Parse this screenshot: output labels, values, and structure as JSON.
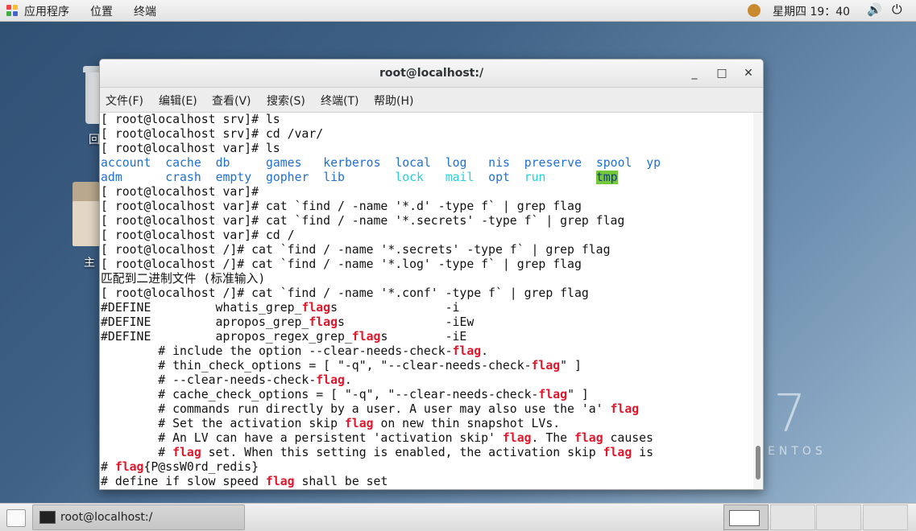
{
  "top_panel": {
    "applications": "应用程序",
    "places": "位置",
    "terminal": "终端",
    "clock": "星期四 19：40"
  },
  "desktop": {
    "trash_label": "回",
    "home_label": "主",
    "brand_number": "7",
    "brand_text": "ENTOS"
  },
  "window": {
    "title": "root@localhost:/",
    "minimize": "_",
    "maximize": "□",
    "close": "✕",
    "menu": [
      "文件(F)",
      "编辑(E)",
      "查看(V)",
      "搜索(S)",
      "终端(T)",
      "帮助(H)"
    ]
  },
  "terminal": {
    "lines": [
      [
        {
          "t": "[ root@localhost srv]# ls"
        }
      ],
      [
        {
          "t": "[ root@localhost srv]# cd /var/"
        }
      ],
      [
        {
          "t": "[ root@localhost var]# ls"
        }
      ],
      [
        {
          "t": "account",
          "c": "blue"
        },
        {
          "t": "  "
        },
        {
          "t": "cache",
          "c": "blue"
        },
        {
          "t": "  "
        },
        {
          "t": "db",
          "c": "blue"
        },
        {
          "t": "     "
        },
        {
          "t": "games",
          "c": "blue"
        },
        {
          "t": "   "
        },
        {
          "t": "kerberos",
          "c": "blue"
        },
        {
          "t": "  "
        },
        {
          "t": "local",
          "c": "blue"
        },
        {
          "t": "  "
        },
        {
          "t": "log",
          "c": "blue"
        },
        {
          "t": "   "
        },
        {
          "t": "nis",
          "c": "blue"
        },
        {
          "t": "  "
        },
        {
          "t": "preserve",
          "c": "blue"
        },
        {
          "t": "  "
        },
        {
          "t": "spool",
          "c": "blue"
        },
        {
          "t": "  "
        },
        {
          "t": "yp",
          "c": "blue"
        }
      ],
      [
        {
          "t": "adm",
          "c": "blue"
        },
        {
          "t": "      "
        },
        {
          "t": "crash",
          "c": "blue"
        },
        {
          "t": "  "
        },
        {
          "t": "empty",
          "c": "blue"
        },
        {
          "t": "  "
        },
        {
          "t": "gopher",
          "c": "blue"
        },
        {
          "t": "  "
        },
        {
          "t": "lib",
          "c": "blue"
        },
        {
          "t": "       "
        },
        {
          "t": "lock",
          "c": "cyan"
        },
        {
          "t": "   "
        },
        {
          "t": "mail",
          "c": "cyan"
        },
        {
          "t": "  "
        },
        {
          "t": "opt",
          "c": "blue"
        },
        {
          "t": "  "
        },
        {
          "t": "run",
          "c": "cyan"
        },
        {
          "t": "       "
        },
        {
          "t": "tmp",
          "c": "tmp"
        }
      ],
      [
        {
          "t": "[ root@localhost var]# "
        }
      ],
      [
        {
          "t": "[ root@localhost var]# cat `find / -name '*.d' -type f` | grep flag"
        }
      ],
      [
        {
          "t": "[ root@localhost var]# cat `find / -name '*.secrets' -type f` | grep flag"
        }
      ],
      [
        {
          "t": "[ root@localhost var]# cd /"
        }
      ],
      [
        {
          "t": "[ root@localhost /]# cat `find / -name '*.secrets' -type f` | grep flag"
        }
      ],
      [
        {
          "t": "[ root@localhost /]# cat `find / -name '*.log' -type f` | grep flag"
        }
      ],
      [
        {
          "t": "匹配到二进制文件 (标准输入)"
        }
      ],
      [
        {
          "t": "[ root@localhost /]# cat `find / -name '*.conf' -type f` | grep flag"
        }
      ],
      [
        {
          "t": "#DEFINE         whatis_grep_"
        },
        {
          "t": "flag",
          "c": "red"
        },
        {
          "t": "s               -i"
        }
      ],
      [
        {
          "t": "#DEFINE         apropos_grep_"
        },
        {
          "t": "flag",
          "c": "red"
        },
        {
          "t": "s              -iEw"
        }
      ],
      [
        {
          "t": "#DEFINE         apropos_regex_grep_"
        },
        {
          "t": "flag",
          "c": "red"
        },
        {
          "t": "s        -iE"
        }
      ],
      [
        {
          "t": "        # include the option --clear-needs-check-"
        },
        {
          "t": "flag",
          "c": "red"
        },
        {
          "t": "."
        }
      ],
      [
        {
          "t": "        # thin_check_options = [ \"-q\", \"--clear-needs-check-"
        },
        {
          "t": "flag",
          "c": "red"
        },
        {
          "t": "\" ]"
        }
      ],
      [
        {
          "t": "        # --clear-needs-check-"
        },
        {
          "t": "flag",
          "c": "red"
        },
        {
          "t": "."
        }
      ],
      [
        {
          "t": "        # cache_check_options = [ \"-q\", \"--clear-needs-check-"
        },
        {
          "t": "flag",
          "c": "red"
        },
        {
          "t": "\" ]"
        }
      ],
      [
        {
          "t": "        # commands run directly by a user. A user may also use the 'a' "
        },
        {
          "t": "flag",
          "c": "red"
        }
      ],
      [
        {
          "t": "        # Set the activation skip "
        },
        {
          "t": "flag",
          "c": "red"
        },
        {
          "t": " on new thin snapshot LVs."
        }
      ],
      [
        {
          "t": "        # An LV can have a persistent 'activation skip' "
        },
        {
          "t": "flag",
          "c": "red"
        },
        {
          "t": ". The "
        },
        {
          "t": "flag",
          "c": "red"
        },
        {
          "t": " causes"
        }
      ],
      [
        {
          "t": "        # "
        },
        {
          "t": "flag",
          "c": "red"
        },
        {
          "t": " set. When this setting is enabled, the activation skip "
        },
        {
          "t": "flag",
          "c": "red"
        },
        {
          "t": " is"
        }
      ],
      [
        {
          "t": "# "
        },
        {
          "t": "flag",
          "c": "red"
        },
        {
          "t": "{P@ssW0rd_redis}"
        }
      ],
      [
        {
          "t": "# define if slow speed "
        },
        {
          "t": "flag",
          "c": "red"
        },
        {
          "t": " shall be set"
        }
      ]
    ]
  },
  "taskbar": {
    "task_label": "root@localhost:/"
  }
}
